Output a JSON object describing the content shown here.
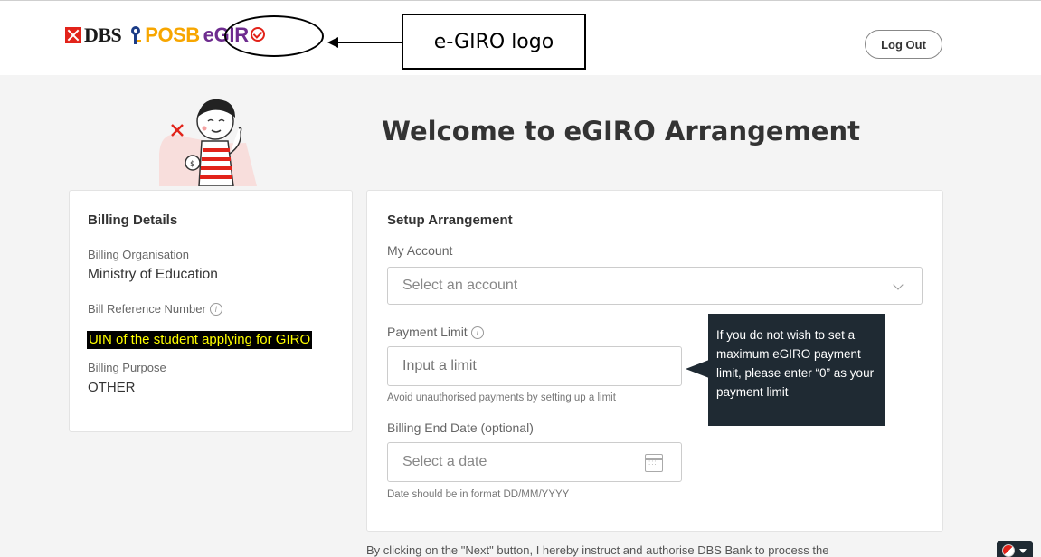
{
  "header": {
    "brand_dbs": "DBS",
    "brand_posb": "POSB",
    "brand_egiro": "eGIR",
    "callout_label": "e-GIRO logo",
    "logout_label": "Log Out"
  },
  "page": {
    "welcome_title": "Welcome to eGIRO Arrangement"
  },
  "billing": {
    "heading": "Billing Details",
    "organisation_label": "Billing Organisation",
    "organisation_value": "Ministry of Education",
    "reference_label": "Bill Reference Number",
    "reference_highlight": "UIN of the student applying for GIRO",
    "purpose_label": "Billing Purpose",
    "purpose_value": "OTHER"
  },
  "setup": {
    "heading": "Setup Arrangement",
    "account_label": "My Account",
    "account_placeholder": "Select an account",
    "limit_label": "Payment Limit",
    "limit_placeholder": "Input a limit",
    "limit_hint": "Avoid unauthorised payments by setting up a limit",
    "end_date_label": "Billing End Date (optional)",
    "end_date_placeholder": "Select a date",
    "end_date_hint": "Date should be in format DD/MM/YYYY"
  },
  "tooltip": {
    "text": "If you do not wish to set a maximum eGIRO payment limit, please enter “0” as your payment limit"
  },
  "footer": {
    "text": "By clicking on the \"Next\" button, I hereby instruct and authorise DBS Bank to process the"
  },
  "icons": {
    "info": "info-icon",
    "dropdown": "chevron-down-icon",
    "calendar": "calendar-icon",
    "language": "language-flag-icon"
  },
  "colors": {
    "dbs_red": "#e2231a",
    "posb_orange": "#f7a600",
    "egiro_purple": "#6e2c8f",
    "tooltip_bg": "#1f2a33",
    "highlight_text": "#ffff00"
  }
}
